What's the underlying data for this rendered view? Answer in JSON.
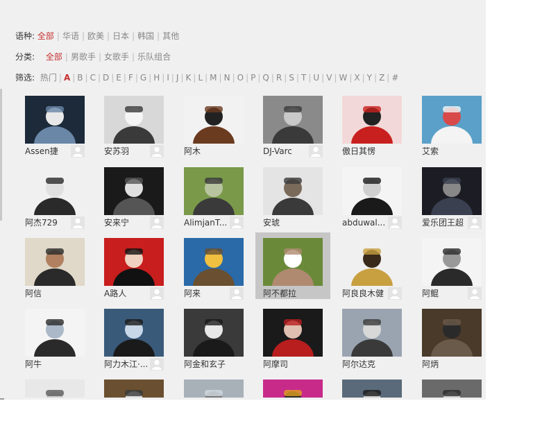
{
  "filters": {
    "language": {
      "label": "语种:",
      "options": [
        "全部",
        "华语",
        "欧美",
        "日本",
        "韩国",
        "其他"
      ],
      "active": 0
    },
    "category": {
      "label": "分类:",
      "options": [
        "全部",
        "男歌手",
        "女歌手",
        "乐队组合"
      ],
      "active": 0
    },
    "filter": {
      "label": "筛选:",
      "options": [
        "热门",
        "A",
        "B",
        "C",
        "D",
        "E",
        "F",
        "G",
        "H",
        "I",
        "J",
        "K",
        "L",
        "M",
        "N",
        "O",
        "P",
        "Q",
        "R",
        "S",
        "T",
        "U",
        "V",
        "W",
        "X",
        "Y",
        "Z",
        "#"
      ],
      "active": 1
    }
  },
  "artists": [
    {
      "name": "Assen捷",
      "icon": "user-icon"
    },
    {
      "name": "安苏羽",
      "icon": "user-icon"
    },
    {
      "name": "阿木",
      "icon": ""
    },
    {
      "name": "DJ-Varc",
      "icon": "user-icon"
    },
    {
      "name": "傲日其愣",
      "icon": ""
    },
    {
      "name": "艾索",
      "icon": ""
    },
    {
      "name": "阿杰729",
      "icon": "user-icon"
    },
    {
      "name": "安来宁",
      "icon": "user-icon"
    },
    {
      "name": "AlimjanT...",
      "icon": "user-icon"
    },
    {
      "name": "安琥",
      "icon": ""
    },
    {
      "name": "abduwal...",
      "icon": "user-icon"
    },
    {
      "name": "爱乐团王超",
      "icon": "user-icon"
    },
    {
      "name": "阿信",
      "icon": ""
    },
    {
      "name": "A路人",
      "icon": "user-icon"
    },
    {
      "name": "阿来",
      "icon": "user-icon"
    },
    {
      "name": "阿不都拉",
      "icon": "",
      "hover": true
    },
    {
      "name": "阿良良木健",
      "icon": "user-icon"
    },
    {
      "name": "阿鲲",
      "icon": "user-icon"
    },
    {
      "name": "阿牛",
      "icon": ""
    },
    {
      "name": "阿力木江·...",
      "icon": "user-icon"
    },
    {
      "name": "阿金和玄子",
      "icon": ""
    },
    {
      "name": "阿摩司",
      "icon": ""
    },
    {
      "name": "阿尔达克",
      "icon": ""
    },
    {
      "name": "阿炳",
      "icon": ""
    },
    {
      "name": "",
      "icon": ""
    },
    {
      "name": "",
      "icon": ""
    },
    {
      "name": "",
      "icon": ""
    },
    {
      "name": "",
      "icon": ""
    },
    {
      "name": "",
      "icon": ""
    },
    {
      "name": "",
      "icon": ""
    }
  ],
  "colors": {
    "accent": "#c62f2f",
    "panel_bg": "#f0f0f0"
  }
}
